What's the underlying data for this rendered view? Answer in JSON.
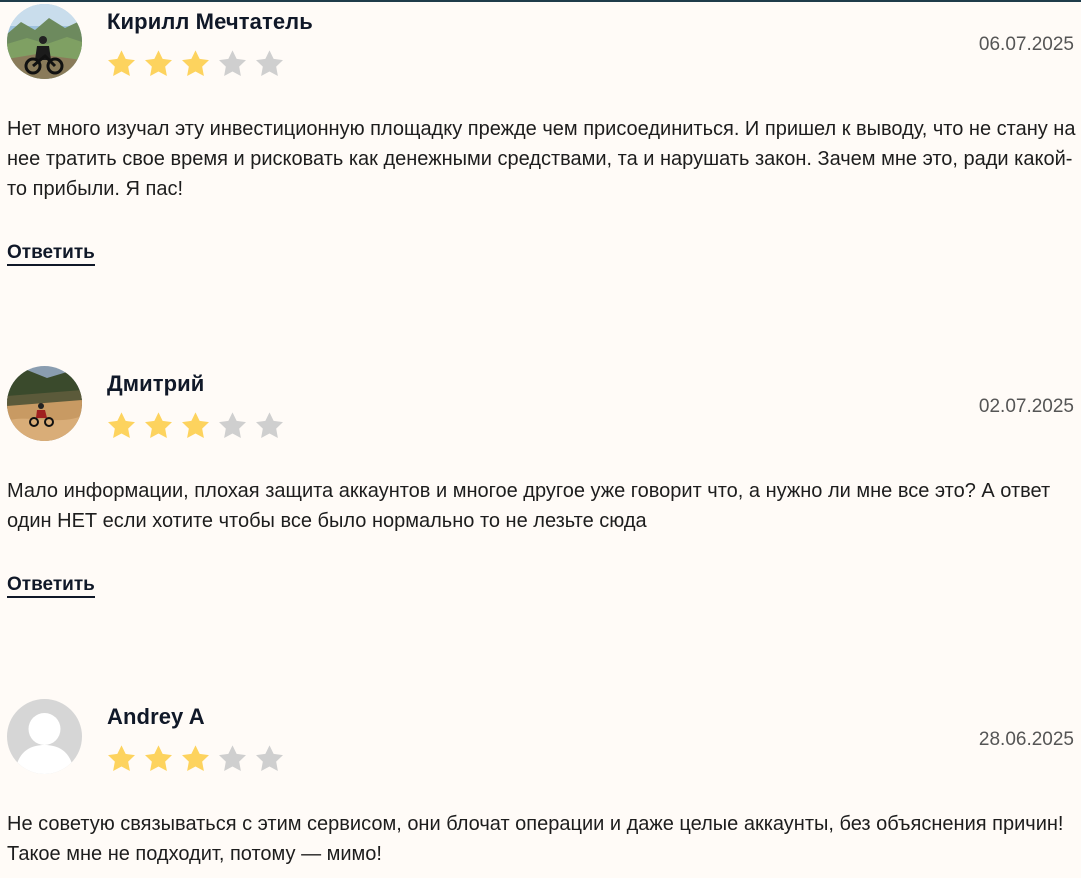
{
  "colors": {
    "background": "#fffbf7",
    "star_filled": "#fdd35e",
    "star_empty": "#cfcfcf",
    "topline": "#1f3c4a"
  },
  "reviews": [
    {
      "author": "Кирилл Мечтатель",
      "date": "06.07.2025",
      "rating": 3,
      "max_rating": 5,
      "avatar": "photo-avatar-motorcycle-mountains",
      "text": "Нет много изучал эту инвестиционную площадку прежде чем присоединиться. И пришел к выводу, что не стану на нее тратить свое время и рисковать как денежными средствами, та и нарушать закон. Зачем мне это, ради какой-то прибыли. Я пас!",
      "reply_label": "Ответить"
    },
    {
      "author": "Дмитрий",
      "date": "02.07.2025",
      "rating": 3,
      "max_rating": 5,
      "avatar": "photo-avatar-dirtbike-hill",
      "text": "Мало информации, плохая защита аккаунтов и многое другое уже говорит что, а нужно ли мне все это? А ответ один НЕТ если хотите чтобы все было нормально то не лезьте сюда",
      "reply_label": "Ответить"
    },
    {
      "author": "Andrey A",
      "date": "28.06.2025",
      "rating": 3,
      "max_rating": 5,
      "avatar": "default-user-icon",
      "text": "Не советую связываться с этим сервисом, они блочат операции и даже целые аккаунты, без объяснения причин! Такое мне не подходит, потому — мимо!",
      "reply_label": ""
    }
  ]
}
